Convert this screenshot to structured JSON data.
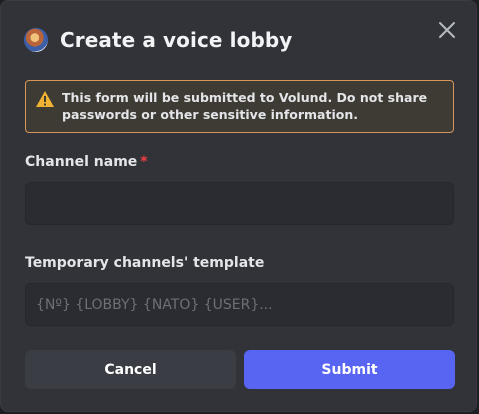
{
  "dialog": {
    "title": "Create a voice lobby",
    "warning": "This form will be submitted to Volund. Do not share passwords or other sensitive information."
  },
  "fields": {
    "channel_name": {
      "label": "Channel name",
      "required_mark": "*",
      "value": "",
      "placeholder": ""
    },
    "template": {
      "label": "Temporary channels' template",
      "value": "",
      "placeholder": "{Nº} {LOBBY} {NATO} {USER}..."
    }
  },
  "buttons": {
    "cancel": "Cancel",
    "submit": "Submit"
  },
  "icons": {
    "app": "app-avatar-icon",
    "close": "close-icon",
    "warning": "warning-triangle-icon"
  },
  "colors": {
    "background": "#313338",
    "warning_border": "#d7965b",
    "required": "#f23f42",
    "submit": "#5865f2",
    "cancel": "#3b3d44"
  }
}
